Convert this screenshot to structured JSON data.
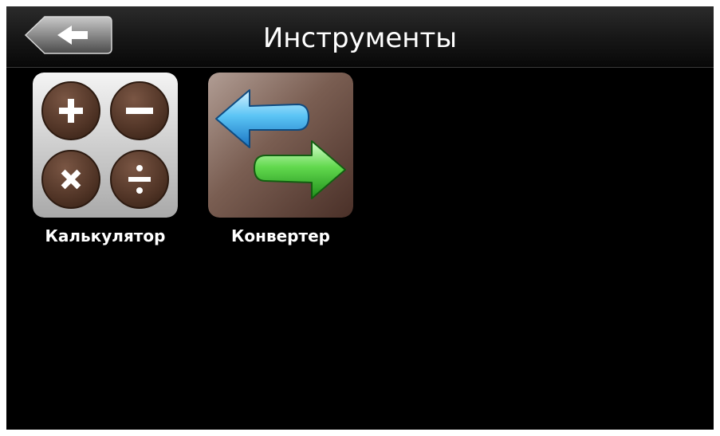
{
  "header": {
    "title": "Инструменты",
    "back_icon": "arrow-left-icon"
  },
  "apps": [
    {
      "label": "Калькулятор",
      "icon": "calculator-icon"
    },
    {
      "label": "Конвертер",
      "icon": "converter-arrows-icon"
    }
  ],
  "colors": {
    "background": "#000000",
    "text": "#ffffff",
    "calc_circle": "#5c3a2a",
    "arrow_blue": "#2aa7e8",
    "arrow_green": "#3ec93a",
    "tile_brown": "#6e4a3a"
  }
}
